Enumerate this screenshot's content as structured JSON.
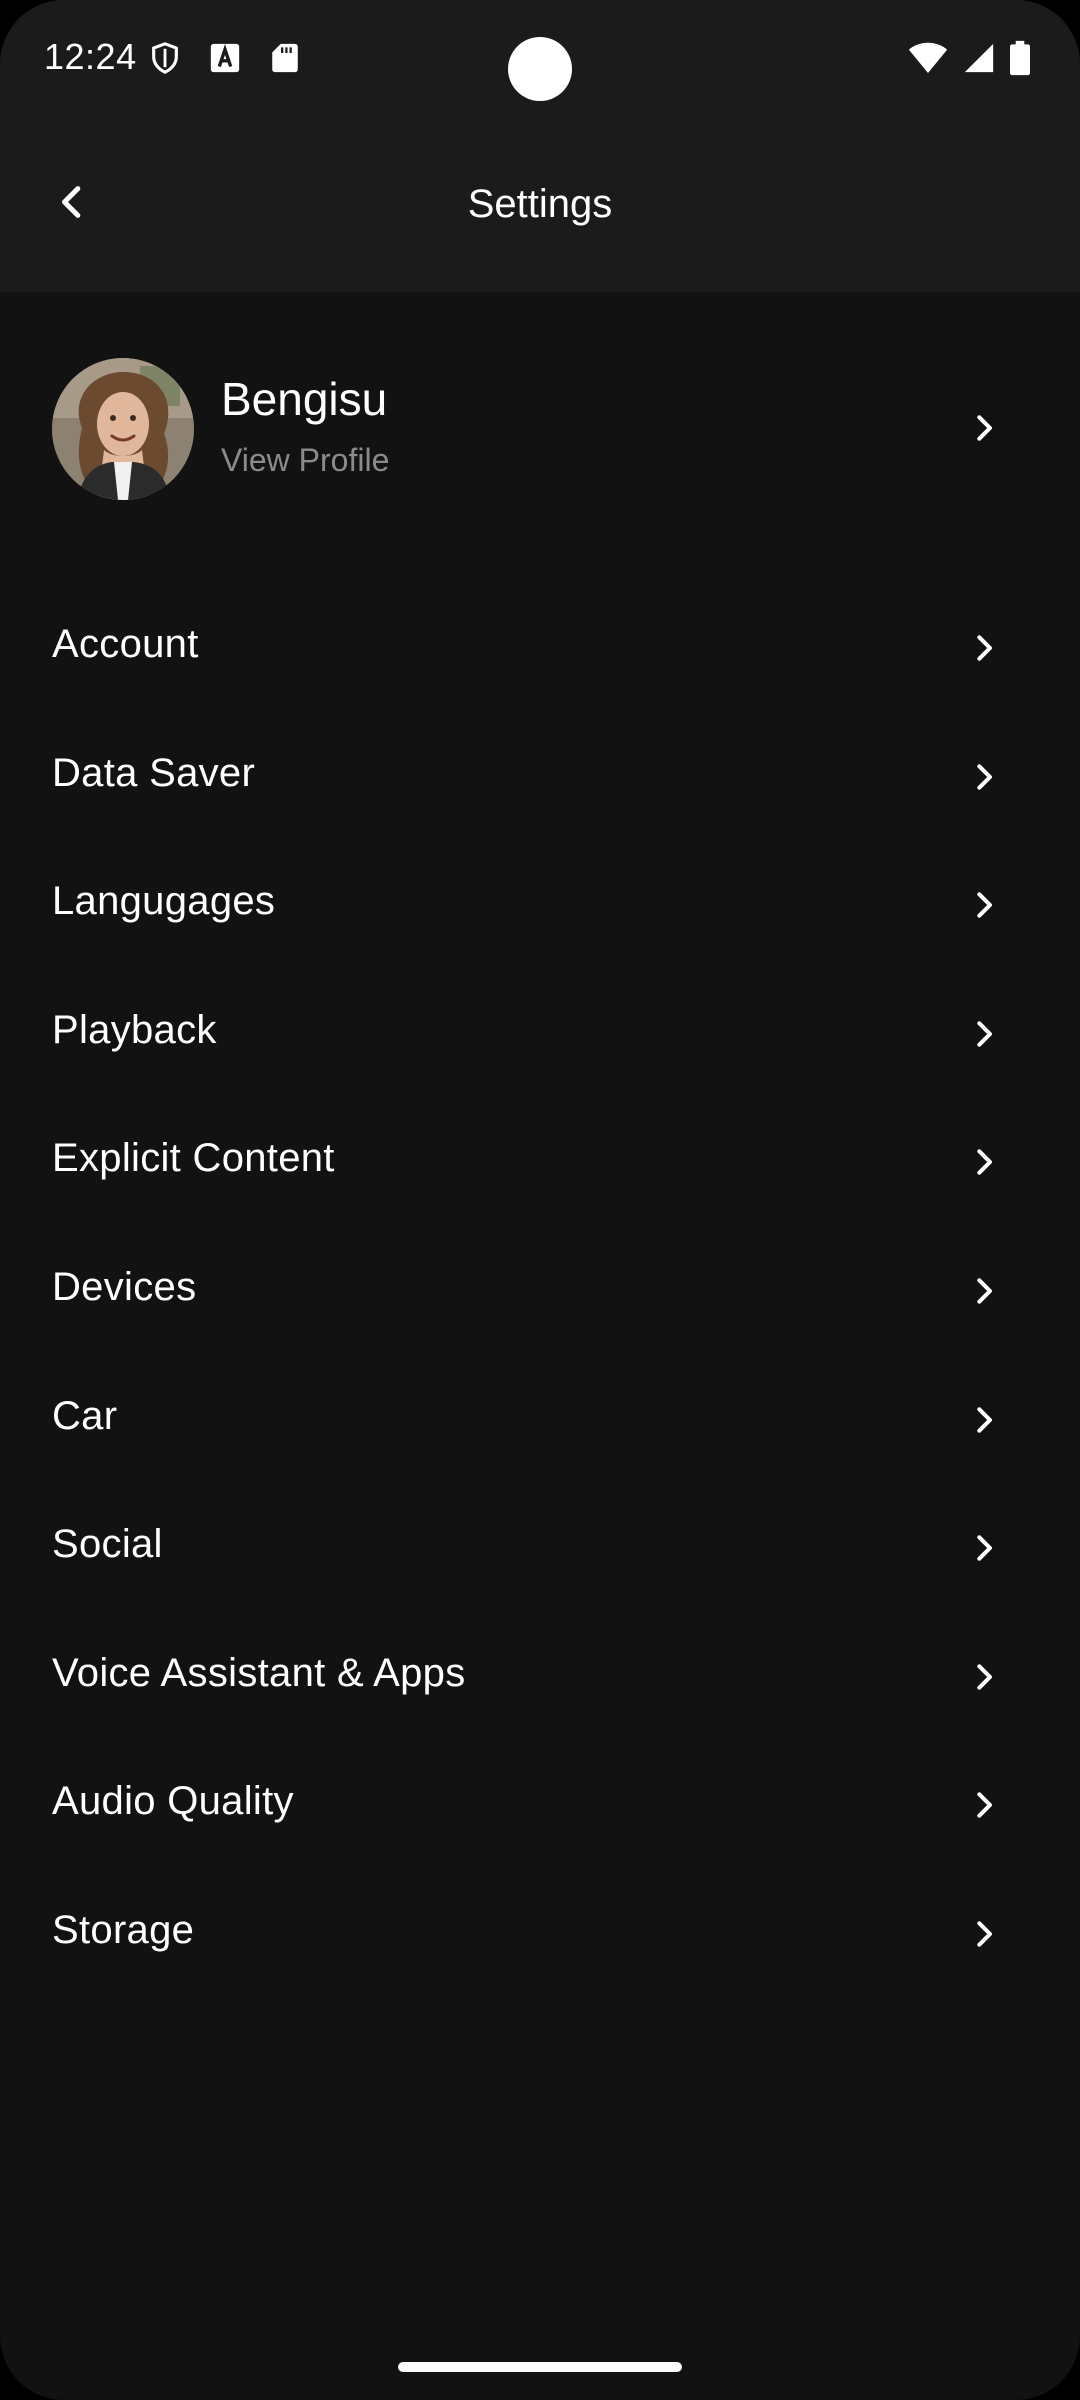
{
  "status_bar": {
    "time": "12:24",
    "icons_left": [
      "shield-icon",
      "font-download-icon",
      "sd-card-icon"
    ],
    "icons_right": [
      "wifi-icon",
      "signal-icon",
      "battery-icon"
    ]
  },
  "app_bar": {
    "title": "Settings",
    "back_icon": "chevron-left-icon"
  },
  "profile": {
    "name": "Bengisu",
    "subtitle": "View Profile"
  },
  "menu": {
    "items": [
      {
        "label": "Account"
      },
      {
        "label": "Data Saver"
      },
      {
        "label": "Langugages"
      },
      {
        "label": "Playback"
      },
      {
        "label": "Explicit Content"
      },
      {
        "label": "Devices"
      },
      {
        "label": "Car"
      },
      {
        "label": "Social"
      },
      {
        "label": "Voice Assistant & Apps"
      },
      {
        "label": "Audio Quality"
      },
      {
        "label": "Storage"
      }
    ]
  },
  "colors": {
    "background": "#121212",
    "bars": "#1b1b1b",
    "text": "#ffffff",
    "subtext": "#8b8b8b"
  }
}
